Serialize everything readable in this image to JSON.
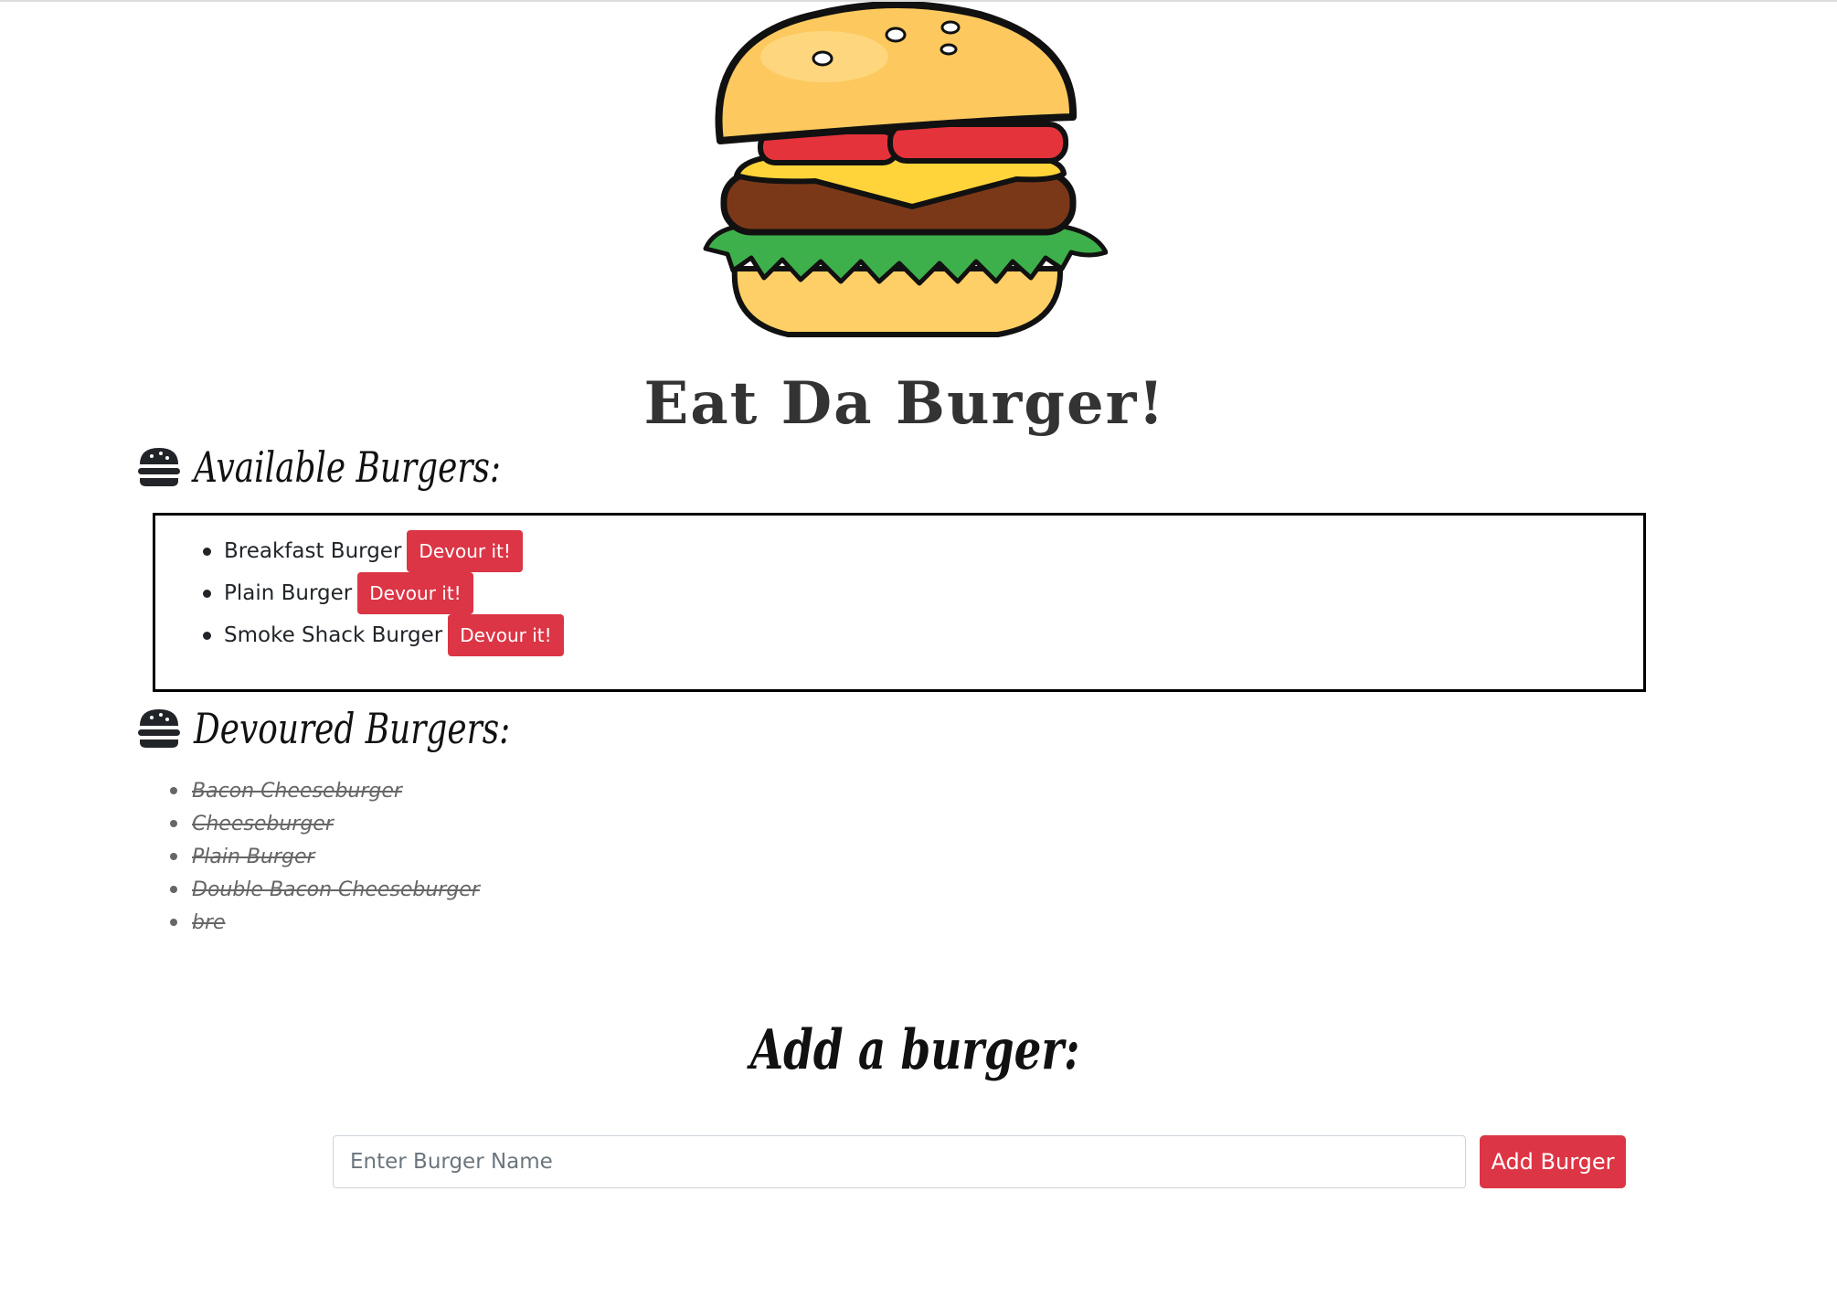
{
  "page": {
    "title": "Eat Da Burger!"
  },
  "hero": {
    "image": "burger-illustration"
  },
  "available": {
    "heading": "Available Burgers:",
    "icon": "burger-icon",
    "items": [
      {
        "name": "Breakfast Burger",
        "button_label": "Devour it!"
      },
      {
        "name": "Plain Burger",
        "button_label": "Devour it!"
      },
      {
        "name": "Smoke Shack Burger",
        "button_label": "Devour it!"
      }
    ]
  },
  "devoured": {
    "heading": "Devoured Burgers:",
    "icon": "burger-icon",
    "items": [
      "Bacon Cheeseburger",
      "Cheeseburger",
      "Plain Burger",
      "Double Bacon Cheeseburger",
      "bre"
    ]
  },
  "add_form": {
    "heading": "Add a burger:",
    "input_placeholder": "Enter Burger Name",
    "input_value": "",
    "button_label": "Add Burger"
  },
  "colors": {
    "danger": "#dc3545",
    "text": "#212529",
    "muted": "#666666",
    "border": "#000000"
  }
}
